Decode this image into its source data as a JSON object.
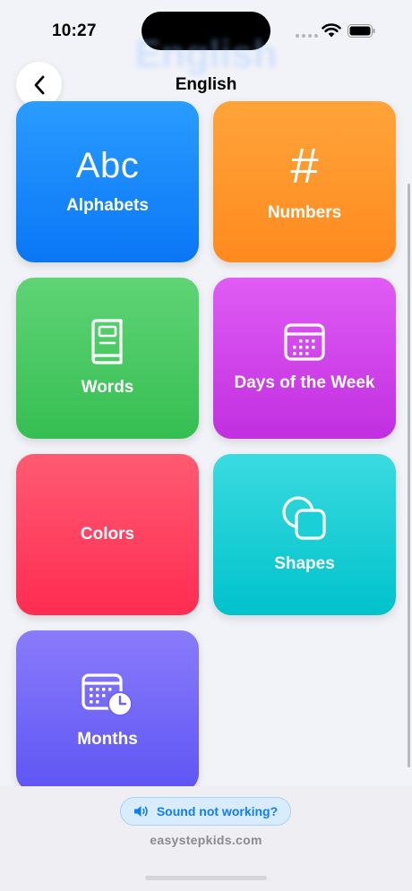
{
  "status_bar": {
    "time": "10:27"
  },
  "header": {
    "ghost_title": "English",
    "title": "English"
  },
  "icons": {
    "back": "chevron-left-icon",
    "numbers": "hash-icon",
    "words": "book-icon",
    "days": "calendar-icon",
    "shapes": "shapes-icon",
    "months": "calendar-clock-icon",
    "sound": "speaker-icon"
  },
  "tiles": [
    {
      "label": "Alphabets",
      "glyph": "Abc",
      "color": "#0a76f6"
    },
    {
      "label": "Numbers",
      "glyph": "#",
      "color": "#ff8a1f"
    },
    {
      "label": "Words",
      "color": "#36be52"
    },
    {
      "label": "Days of the Week",
      "color": "#c12fe0"
    },
    {
      "label": "Colors",
      "color": "#ff2c52"
    },
    {
      "label": "Shapes",
      "color": "#00c2cb"
    },
    {
      "label": "Months",
      "color": "#5e55f3"
    }
  ],
  "footer": {
    "sound_label": "Sound not working?",
    "site": "easystepkids.com"
  }
}
